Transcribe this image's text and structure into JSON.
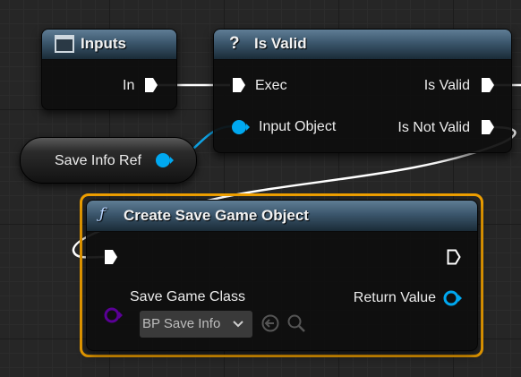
{
  "inputs_node": {
    "title": "Inputs",
    "title_icon": "frame-icon",
    "pin_in": "In"
  },
  "is_valid_node": {
    "title_icon_glyph": "?",
    "title": "Is Valid",
    "pin_exec": "Exec",
    "pin_input_object": "Input Object",
    "pin_is_valid": "Is Valid",
    "pin_is_not_valid": "Is Not Valid"
  },
  "variable_node": {
    "label": "Save Info Ref"
  },
  "create_node": {
    "title_icon_glyph": "ƒ",
    "title": "Create Save Game Object",
    "pin_save_game_class": "Save Game Class",
    "class_value": "BP Save Info",
    "pin_return_value": "Return Value",
    "selected": true
  },
  "colors": {
    "exec_pin": "#ffffff",
    "object_pin": "#00a8f0",
    "class_pin": "#5a0096",
    "selection": "#f0a000",
    "header": "#4a6880",
    "wire_object": "#0fa4e6"
  }
}
